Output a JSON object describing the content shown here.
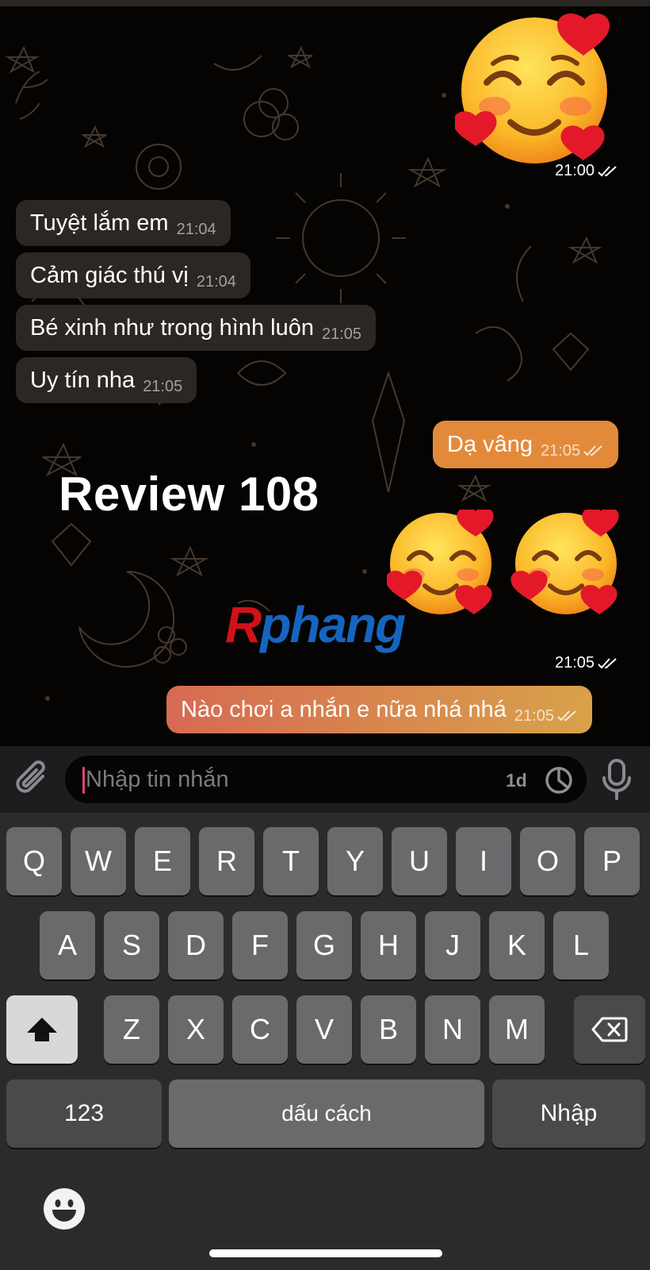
{
  "chat": {
    "incoming": [
      {
        "text": "Tuyệt lắm em",
        "time": "21:04"
      },
      {
        "text": "Cảm giác thú vị",
        "time": "21:04"
      },
      {
        "text": "Bé xinh như trong hình luôn",
        "time": "21:05"
      },
      {
        "text": "Uy tín nha",
        "time": "21:05"
      }
    ],
    "outgoing": [
      {
        "text": "Dạ vâng",
        "time": "21:05"
      },
      {
        "text": "Nào chơi a nhắn e nữa nhá nhá",
        "time": "21:05"
      }
    ],
    "stickers": [
      {
        "icon": "smiling-face-with-hearts",
        "time": "21:00"
      },
      {
        "icon": "smiling-face-with-hearts-double",
        "time": "21:05"
      }
    ],
    "overlay_title": "Review 108",
    "overlay_logo_first": "R",
    "overlay_logo_rest": "phang"
  },
  "input": {
    "placeholder": "Nhập tin nhắn",
    "timer_label": "1d",
    "icons": [
      "paperclip-icon",
      "timer-icon",
      "microphone-icon"
    ]
  },
  "keyboard": {
    "row1": [
      "Q",
      "W",
      "E",
      "R",
      "T",
      "Y",
      "U",
      "I",
      "O",
      "P"
    ],
    "row2": [
      "A",
      "S",
      "D",
      "F",
      "G",
      "H",
      "J",
      "K",
      "L"
    ],
    "row3": [
      "Z",
      "X",
      "C",
      "V",
      "B",
      "N",
      "M"
    ],
    "numbers_label": "123",
    "space_label": "dấu cách",
    "return_label": "Nhập"
  },
  "colors": {
    "incoming_bubble": "#2b2724",
    "outgoing_orange": "#e38a3a",
    "outgoing_gradient_start": "#d66a52",
    "outgoing_gradient_end": "#d9a24a"
  }
}
